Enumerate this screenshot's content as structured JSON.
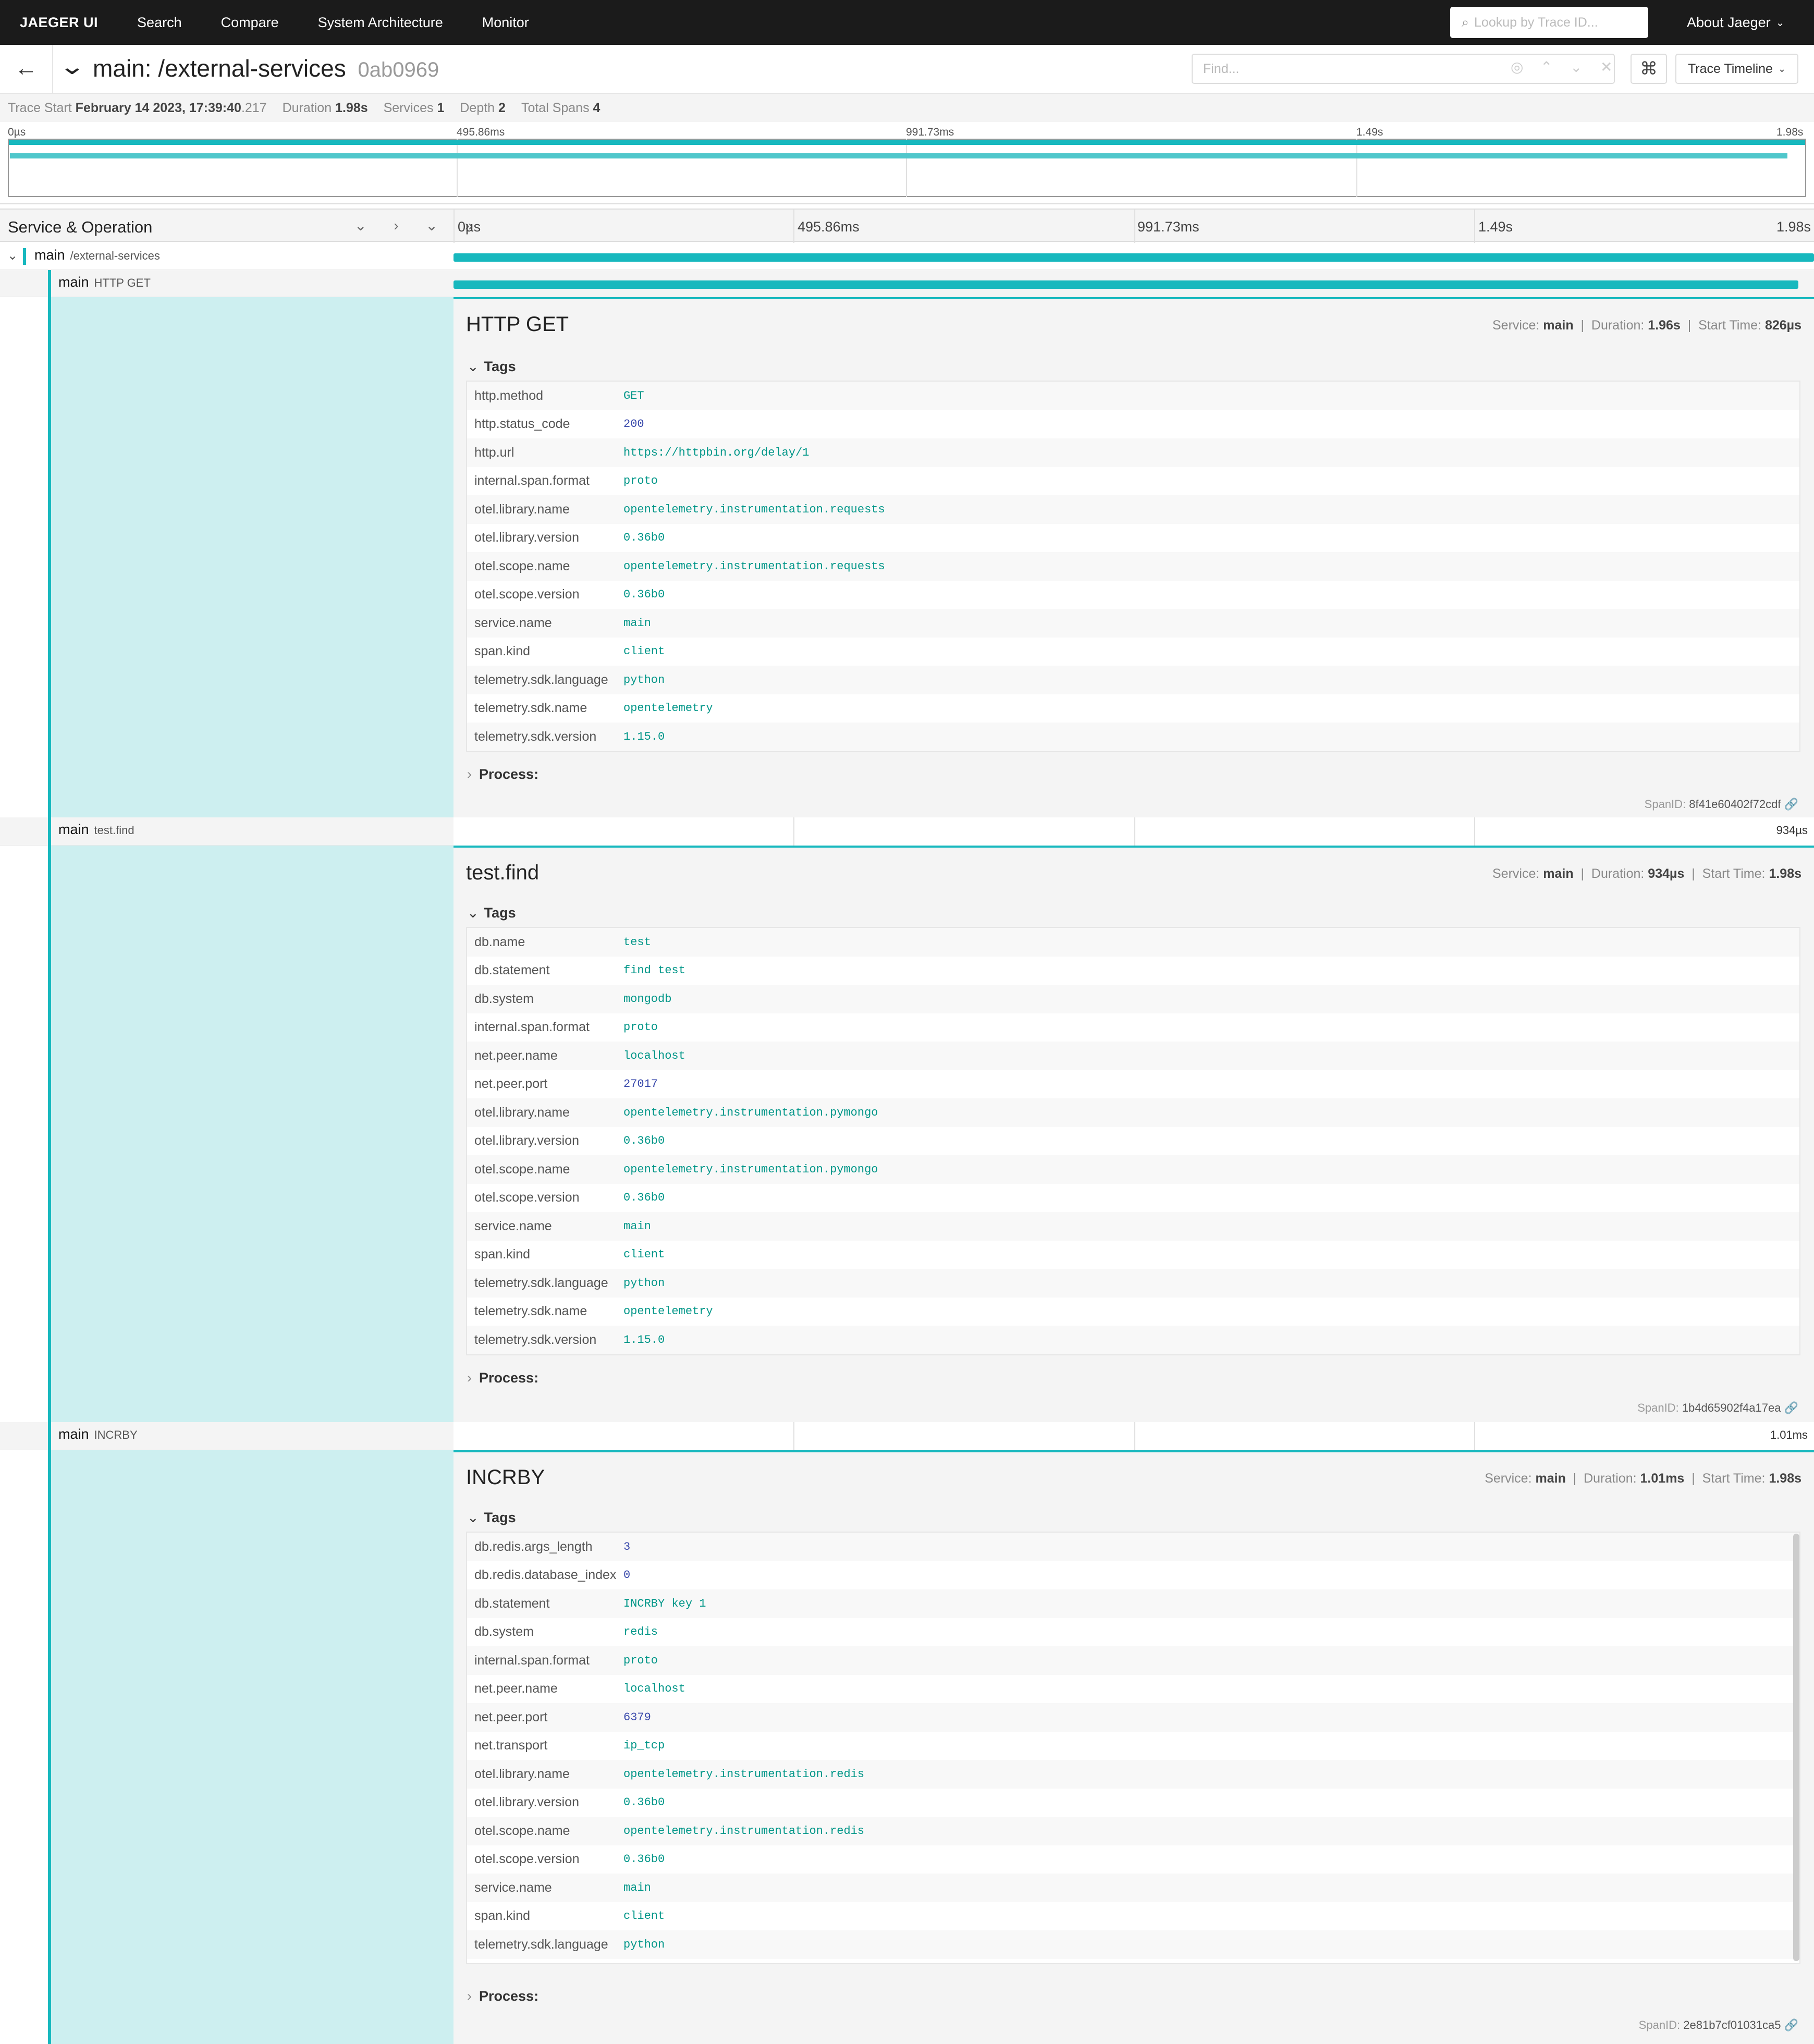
{
  "nav": {
    "brand": "JAEGER UI",
    "search": "Search",
    "compare": "Compare",
    "system_architecture": "System Architecture",
    "monitor": "Monitor",
    "lookup_placeholder": "Lookup by Trace ID...",
    "about": "About Jaeger"
  },
  "trace": {
    "title": "main: /external-services",
    "trace_id": "0ab0969",
    "find_placeholder": "Find...",
    "view_selector": "Trace Timeline"
  },
  "summary": {
    "trace_start_label": "Trace Start",
    "trace_start_date": "February 14 2023, 17:39:40",
    "trace_start_ms": ".217",
    "duration_label": "Duration",
    "duration": "1.98s",
    "services_label": "Services",
    "services": "1",
    "depth_label": "Depth",
    "depth": "2",
    "total_spans_label": "Total Spans",
    "total_spans": "4"
  },
  "ticks": [
    "0µs",
    "495.86ms",
    "991.73ms",
    "1.49s",
    "1.98s"
  ],
  "header": {
    "label": "Service & Operation"
  },
  "rows": {
    "root": {
      "service": "main",
      "operation": "/external-services"
    },
    "http": {
      "service": "main",
      "operation": "HTTP GET"
    },
    "find": {
      "service": "main",
      "operation": "test.find",
      "duration": "934µs"
    },
    "incr": {
      "service": "main",
      "operation": "INCRBY",
      "duration": "1.01ms"
    }
  },
  "spans": {
    "http": {
      "title": "HTTP GET",
      "service_label": "Service:",
      "service": "main",
      "duration_label": "Duration:",
      "duration": "1.96s",
      "start_label": "Start Time:",
      "start": "826µs",
      "tags_label": "Tags",
      "process_label": "Process:",
      "spanid_label": "SpanID:",
      "spanid": "8f41e60402f72cdf",
      "tags": [
        [
          "http.method",
          "GET"
        ],
        [
          "http.status_code",
          "200"
        ],
        [
          "http.url",
          "https://httpbin.org/delay/1"
        ],
        [
          "internal.span.format",
          "proto"
        ],
        [
          "otel.library.name",
          "opentelemetry.instrumentation.requests"
        ],
        [
          "otel.library.version",
          "0.36b0"
        ],
        [
          "otel.scope.name",
          "opentelemetry.instrumentation.requests"
        ],
        [
          "otel.scope.version",
          "0.36b0"
        ],
        [
          "service.name",
          "main"
        ],
        [
          "span.kind",
          "client"
        ],
        [
          "telemetry.sdk.language",
          "python"
        ],
        [
          "telemetry.sdk.name",
          "opentelemetry"
        ],
        [
          "telemetry.sdk.version",
          "1.15.0"
        ]
      ]
    },
    "find": {
      "title": "test.find",
      "service_label": "Service:",
      "service": "main",
      "duration_label": "Duration:",
      "duration": "934µs",
      "start_label": "Start Time:",
      "start": "1.98s",
      "tags_label": "Tags",
      "process_label": "Process:",
      "spanid_label": "SpanID:",
      "spanid": "1b4d65902f4a17ea",
      "tags": [
        [
          "db.name",
          "test"
        ],
        [
          "db.statement",
          "find test"
        ],
        [
          "db.system",
          "mongodb"
        ],
        [
          "internal.span.format",
          "proto"
        ],
        [
          "net.peer.name",
          "localhost"
        ],
        [
          "net.peer.port",
          "27017"
        ],
        [
          "otel.library.name",
          "opentelemetry.instrumentation.pymongo"
        ],
        [
          "otel.library.version",
          "0.36b0"
        ],
        [
          "otel.scope.name",
          "opentelemetry.instrumentation.pymongo"
        ],
        [
          "otel.scope.version",
          "0.36b0"
        ],
        [
          "service.name",
          "main"
        ],
        [
          "span.kind",
          "client"
        ],
        [
          "telemetry.sdk.language",
          "python"
        ],
        [
          "telemetry.sdk.name",
          "opentelemetry"
        ],
        [
          "telemetry.sdk.version",
          "1.15.0"
        ]
      ]
    },
    "incr": {
      "title": "INCRBY",
      "service_label": "Service:",
      "service": "main",
      "duration_label": "Duration:",
      "duration": "1.01ms",
      "start_label": "Start Time:",
      "start": "1.98s",
      "tags_label": "Tags",
      "process_label": "Process:",
      "spanid_label": "SpanID:",
      "spanid": "2e81b7cf01031ca5",
      "tags": [
        [
          "db.redis.args_length",
          "3"
        ],
        [
          "db.redis.database_index",
          "0"
        ],
        [
          "db.statement",
          "INCRBY key 1"
        ],
        [
          "db.system",
          "redis"
        ],
        [
          "internal.span.format",
          "proto"
        ],
        [
          "net.peer.name",
          "localhost"
        ],
        [
          "net.peer.port",
          "6379"
        ],
        [
          "net.transport",
          "ip_tcp"
        ],
        [
          "otel.library.name",
          "opentelemetry.instrumentation.redis"
        ],
        [
          "otel.library.version",
          "0.36b0"
        ],
        [
          "otel.scope.name",
          "opentelemetry.instrumentation.redis"
        ],
        [
          "otel.scope.version",
          "0.36b0"
        ],
        [
          "service.name",
          "main"
        ],
        [
          "span.kind",
          "client"
        ],
        [
          "telemetry.sdk.language",
          "python"
        ]
      ]
    }
  }
}
